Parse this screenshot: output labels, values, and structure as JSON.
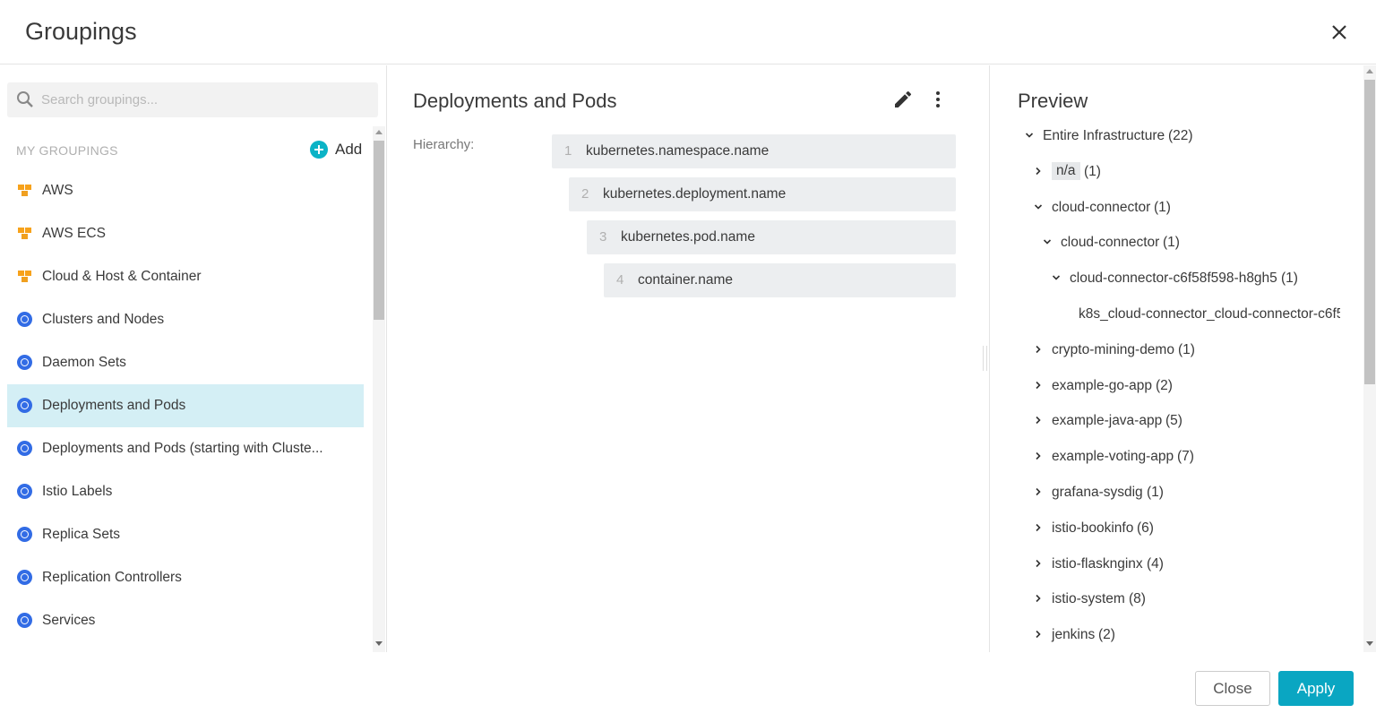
{
  "dialog": {
    "title": "Groupings"
  },
  "search": {
    "placeholder": "Search groupings..."
  },
  "sidebar": {
    "section_label": "MY GROUPINGS",
    "add_label": "Add",
    "items": [
      {
        "label": "AWS",
        "icon": "aws-cubes-icon"
      },
      {
        "label": "AWS ECS",
        "icon": "aws-cubes-icon"
      },
      {
        "label": "Cloud & Host & Container",
        "icon": "aws-cubes-icon"
      },
      {
        "label": "Clusters and Nodes",
        "icon": "kubernetes-icon"
      },
      {
        "label": "Daemon Sets",
        "icon": "kubernetes-icon"
      },
      {
        "label": "Deployments and Pods",
        "icon": "kubernetes-icon",
        "selected": true
      },
      {
        "label": "Deployments and Pods (starting with Cluste...",
        "icon": "kubernetes-icon"
      },
      {
        "label": "Istio Labels",
        "icon": "kubernetes-icon"
      },
      {
        "label": "Replica Sets",
        "icon": "kubernetes-icon"
      },
      {
        "label": "Replication Controllers",
        "icon": "kubernetes-icon"
      },
      {
        "label": "Services",
        "icon": "kubernetes-icon"
      }
    ]
  },
  "main": {
    "title": "Deployments and Pods",
    "hierarchy_label": "Hierarchy:",
    "levels": [
      {
        "num": "1",
        "label": "kubernetes.namespace.name"
      },
      {
        "num": "2",
        "label": "kubernetes.deployment.name"
      },
      {
        "num": "3",
        "label": "kubernetes.pod.name"
      },
      {
        "num": "4",
        "label": "container.name"
      }
    ]
  },
  "preview": {
    "title": "Preview",
    "nodes": [
      {
        "label": "Entire Infrastructure",
        "count": "(22)",
        "state": "expanded"
      },
      {
        "label": "n/a",
        "count": "(1)",
        "state": "collapsed",
        "highlight": true
      },
      {
        "label": "cloud-connector",
        "count": "(1)",
        "state": "expanded"
      },
      {
        "label": "cloud-connector",
        "count": "(1)",
        "state": "expanded"
      },
      {
        "label": "cloud-connector-c6f58f598-h8gh5",
        "count": "(1)",
        "state": "expanded"
      },
      {
        "label": "k8s_cloud-connector_cloud-connector-c6f5",
        "count": "",
        "state": "leaf"
      },
      {
        "label": "crypto-mining-demo",
        "count": "(1)",
        "state": "collapsed"
      },
      {
        "label": "example-go-app",
        "count": "(2)",
        "state": "collapsed"
      },
      {
        "label": "example-java-app",
        "count": "(5)",
        "state": "collapsed"
      },
      {
        "label": "example-voting-app",
        "count": "(7)",
        "state": "collapsed"
      },
      {
        "label": "grafana-sysdig",
        "count": "(1)",
        "state": "collapsed"
      },
      {
        "label": "istio-bookinfo",
        "count": "(6)",
        "state": "collapsed"
      },
      {
        "label": "istio-flasknginx",
        "count": "(4)",
        "state": "collapsed"
      },
      {
        "label": "istio-system",
        "count": "(8)",
        "state": "collapsed"
      },
      {
        "label": "jenkins",
        "count": "(2)",
        "state": "collapsed"
      }
    ]
  },
  "footer": {
    "close_label": "Close",
    "apply_label": "Apply"
  },
  "colors": {
    "accent": "#0aa6c2",
    "selected_row": "#d4eff5",
    "k8s_blue": "#326ce5",
    "aws_orange": "#f7a21b"
  }
}
